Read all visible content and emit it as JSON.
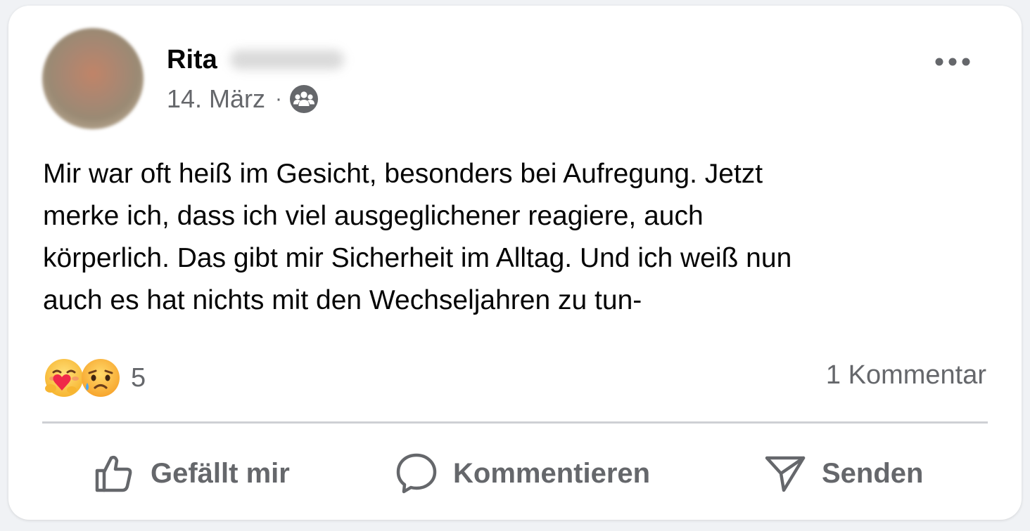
{
  "post": {
    "author_first_name": "Rita",
    "date": "14. März",
    "meta_separator": "·",
    "audience_icon": "friends-group-icon",
    "more_icon": "more-horizontal-icon",
    "text": "Mir war oft heiß im Gesicht, besonders bei Aufregung. Jetzt\nmerke ich, dass ich viel ausgeglichener reagiere, auch\nkörperlich. Das gibt mir Sicherheit im Alltag. Und ich weiß nun\nauch es hat nichts mit den Wechseljahren zu tun-"
  },
  "reactions": {
    "icons": [
      "care-reaction-icon",
      "sad-reaction-icon"
    ],
    "count": "5"
  },
  "comments": {
    "count_label": "1 Kommentar"
  },
  "actions": {
    "like_label": "Gefällt mir",
    "comment_label": "Kommentieren",
    "send_label": "Senden"
  },
  "colors": {
    "text_primary": "#050505",
    "text_secondary": "#65676b",
    "divider": "#ced0d4",
    "card_background": "#ffffff"
  }
}
